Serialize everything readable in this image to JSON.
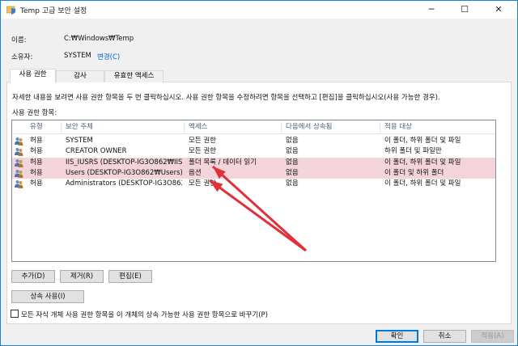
{
  "window": {
    "title": "Temp 고급 보안 설정",
    "minimize": "─",
    "maximize": "☐",
    "close": "✕"
  },
  "info": {
    "name_label": "이름:",
    "name_value": "C:₩Windows₩Temp",
    "owner_label": "소유자:",
    "owner_value": "SYSTEM",
    "change_link": "변경(C)"
  },
  "tabs": [
    {
      "label": "사용 권한",
      "active": true
    },
    {
      "label": "감사",
      "active": false
    },
    {
      "label": "유효한 액세스",
      "active": false
    }
  ],
  "instructions": "자세한 내용을 보려면 사용 권한 항목을 두 번 클릭하십시오. 사용 권한 항목을 수정하려면 항목을 선택하고 [편집]을 클릭하십시오(사용 가능한 경우).",
  "entries_label": "사용 권한 항목:",
  "table": {
    "columns": [
      "유형",
      "보안 주체",
      "액세스",
      "다음에서 상속됨",
      "적용 대상"
    ],
    "rows": [
      {
        "type": "허용",
        "principal": "SYSTEM",
        "access": "모든 권한",
        "inherited": "없음",
        "applies": "이 폴더, 하위 폴더 및 파일",
        "highlight": false
      },
      {
        "type": "허용",
        "principal": "CREATOR OWNER",
        "access": "모든 권한",
        "inherited": "없음",
        "applies": "하위 폴더 및 파일만",
        "highlight": false
      },
      {
        "type": "허용",
        "principal": "IIS_IUSRS (DESKTOP-IG3O862₩IIS_...",
        "access": "폴더 목록 / 데이터 읽기",
        "inherited": "없음",
        "applies": "이 폴더, 하위 폴더 및 파일",
        "highlight": true
      },
      {
        "type": "허용",
        "principal": "Users (DESKTOP-IG3O862₩Users)",
        "access": "옵션",
        "inherited": "없음",
        "applies": "이 폴더 및 하위 폴더",
        "highlight": true
      },
      {
        "type": "허용",
        "principal": "Administrators (DESKTOP-IG3O862...",
        "access": "모든 권한",
        "inherited": "없음",
        "applies": "이 폴더, 하위 폴더 및 파일",
        "highlight": false
      }
    ]
  },
  "buttons": {
    "add": "추가(D)",
    "remove": "제거(R)",
    "edit": "편집(E)",
    "inherit": "상속 사용(I)",
    "ok": "확인",
    "cancel": "취소",
    "apply": "적용(A)"
  },
  "checkbox_label": "모든 자식 개체 사용 권한 항목을 이 개체의 상속 가능한 사용 권한 항목으로 바꾸기(P)",
  "colors": {
    "highlight": "#f2d4da",
    "arrow": "#e0303a",
    "link": "#0066cc",
    "window_border": "#1883d7"
  }
}
